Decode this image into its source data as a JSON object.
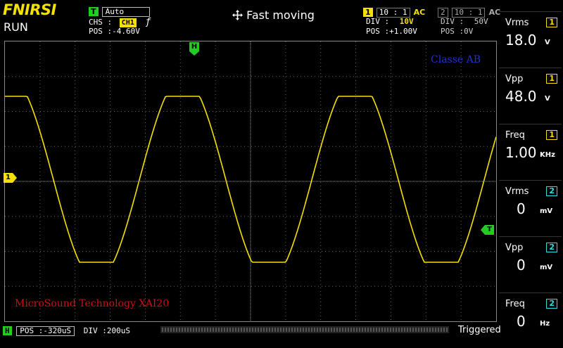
{
  "header": {
    "brand": "FNIRSI",
    "run_state": "RUN",
    "trigger_mode_badge": "T",
    "trigger_mode": "Auto",
    "chs_label": "CHS :",
    "chs_value": "CH1",
    "edge_symbol": "ƒ",
    "pos_label": "POS :",
    "pos_value": "-4.60V",
    "mode_icon": "move-arrows-icon",
    "mode_text": "Fast moving"
  },
  "channel1": {
    "badge": "1",
    "probe": "10 : 1",
    "coupling": "AC",
    "div_label": "DIV :",
    "div_value": "10V",
    "pos_label": "POS :",
    "pos_value": "+1.00V"
  },
  "channel2": {
    "badge": "2",
    "probe": "10 : 1",
    "coupling": "AC",
    "div_label": "DIV :",
    "div_value": "50V",
    "pos_label": "POS :",
    "pos_value": "0V"
  },
  "screen": {
    "annotation_top": "Classe AB",
    "annotation_bottom": "MicroSound Technology XAI20",
    "h_marker": "H",
    "ch1_marker": "1",
    "trigger_marker": "T",
    "colors": {
      "ch1": "#f5e000",
      "grid": "#888888",
      "annotation_top": "#2233cc",
      "annotation_bottom": "#cc1111",
      "marker": "#22cc22"
    }
  },
  "measurements": [
    {
      "name": "Vrms",
      "channel": "1",
      "value": "18.0",
      "unit": "V"
    },
    {
      "name": "Vpp",
      "channel": "1",
      "value": "48.0",
      "unit": "V"
    },
    {
      "name": "Freq",
      "channel": "1",
      "value": "1.00",
      "unit": "KHz"
    },
    {
      "name": "Vrms",
      "channel": "2",
      "value": "0",
      "unit": "mV"
    },
    {
      "name": "Vpp",
      "channel": "2",
      "value": "0",
      "unit": "mV"
    },
    {
      "name": "Freq",
      "channel": "2",
      "value": "0",
      "unit": "Hz"
    }
  ],
  "footer": {
    "h_badge": "H",
    "pos_label": "POS :",
    "pos_value": "-320uS",
    "div_label": "DIV :",
    "div_value": "200uS",
    "status": "Triggered"
  }
}
